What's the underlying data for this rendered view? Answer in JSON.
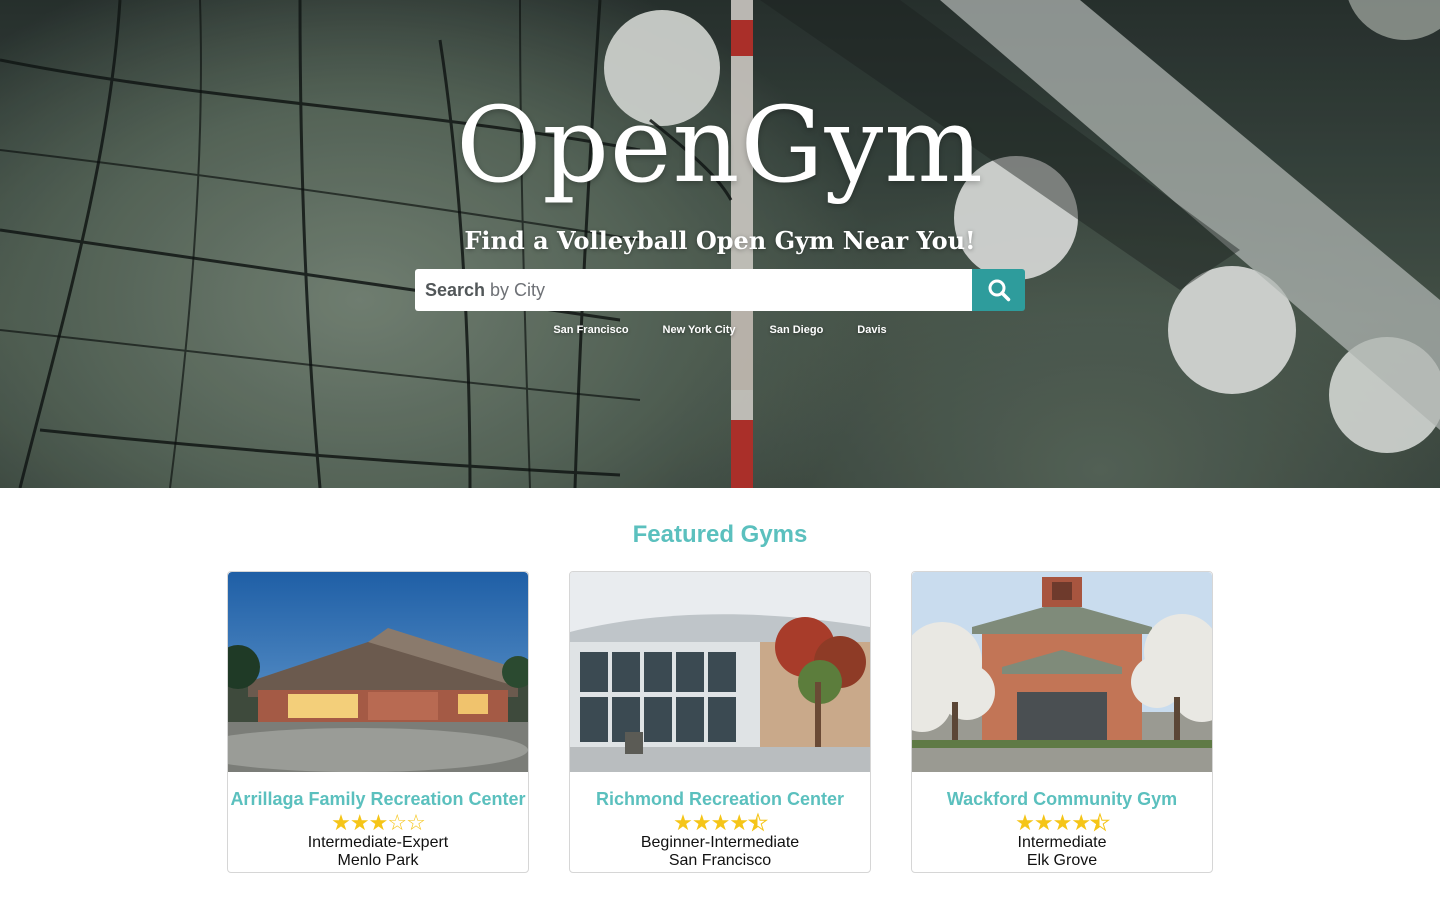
{
  "hero": {
    "title": "OpenGym",
    "tagline": "Find a Volleyball Open Gym Near You!",
    "search": {
      "placeholder_bold": "Search",
      "placeholder_rest": " by City",
      "placeholder": "Search by City"
    },
    "quick_links": [
      "San Francisco",
      "New York City",
      "San Diego",
      "Davis"
    ]
  },
  "featured": {
    "title": "Featured Gyms",
    "gyms": [
      {
        "name": "Arrillaga Family Recreation Center",
        "rating": 3,
        "level": "Intermediate-Expert",
        "city": "Menlo Park"
      },
      {
        "name": "Richmond Recreation Center",
        "rating": 4.5,
        "level": "Beginner-Intermediate",
        "city": "San Francisco"
      },
      {
        "name": "Wackford Community Gym",
        "rating": 4.5,
        "level": "Intermediate",
        "city": "Elk Grove"
      }
    ]
  },
  "colors": {
    "accent": "#5bc0be",
    "search_button": "#2e9c9c",
    "star": "#f5c518"
  },
  "icons": {
    "search_button": "search-icon"
  }
}
